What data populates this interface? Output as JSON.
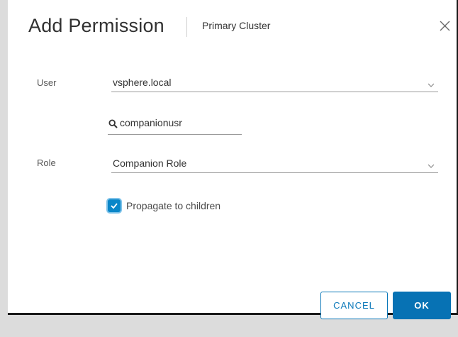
{
  "dialog": {
    "title": "Add Permission",
    "subtitle": "Primary Cluster",
    "close_icon": "close-icon"
  },
  "user": {
    "label": "User",
    "domain_value": "vsphere.local",
    "search_icon": "search-icon",
    "search_value": "companionusr"
  },
  "role": {
    "label": "Role",
    "value": "Companion Role"
  },
  "propagate": {
    "label": "Propagate to children",
    "checked": true
  },
  "buttons": {
    "cancel_label": "CANCEL",
    "ok_label": "OK"
  },
  "colors": {
    "accent": "#0772b4",
    "checkbox": "#0a86c8"
  }
}
